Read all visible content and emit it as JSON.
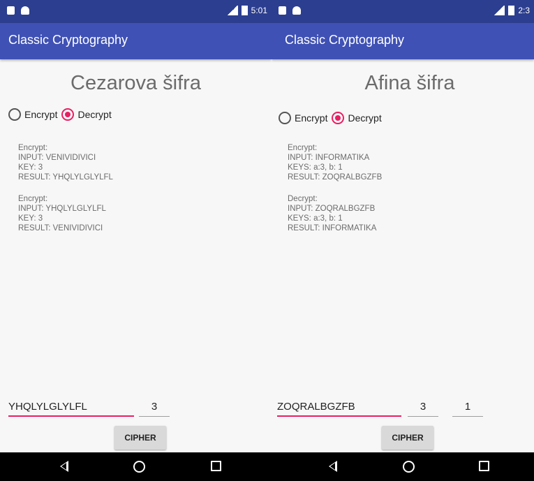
{
  "screens": [
    {
      "status_time": "5:01",
      "app_title": "Classic Cryptography",
      "heading": "Cezarova šifra",
      "mode": {
        "encrypt_label": "Encrypt",
        "decrypt_label": "Decrypt",
        "selected": "Decrypt"
      },
      "examples": [
        [
          "Encrypt:",
          "INPUT: VENIVIDIVICI",
          "KEY: 3",
          "RESULT: YHQLYLGLYLFL"
        ],
        [
          "Encrypt:",
          "INPUT: YHQLYLGLYLFL",
          "KEY: 3",
          "RESULT: VENIVIDIVICI"
        ]
      ],
      "input_value": "YHQLYLGLYLFL",
      "key_value": "3",
      "button_label": "CIPHER"
    },
    {
      "status_time": "2:3",
      "app_title": "Classic Cryptography",
      "heading": "Afina šifra",
      "mode": {
        "encrypt_label": "Encrypt",
        "decrypt_label": "Decrypt",
        "selected": "Decrypt"
      },
      "examples": [
        [
          "Encrypt:",
          "INPUT: INFORMATIKA",
          "KEYS: a:3, b: 1",
          "RESULT: ZOQRALBGZFB"
        ],
        [
          "Decrypt:",
          "INPUT: ZOQRALBGZFB",
          "KEYS: a:3, b: 1",
          "RESULT: INFORMATIKA"
        ]
      ],
      "input_value": "ZOQRALBGZFB",
      "key_a_value": "3",
      "key_b_value": "1",
      "button_label": "CIPHER"
    }
  ]
}
